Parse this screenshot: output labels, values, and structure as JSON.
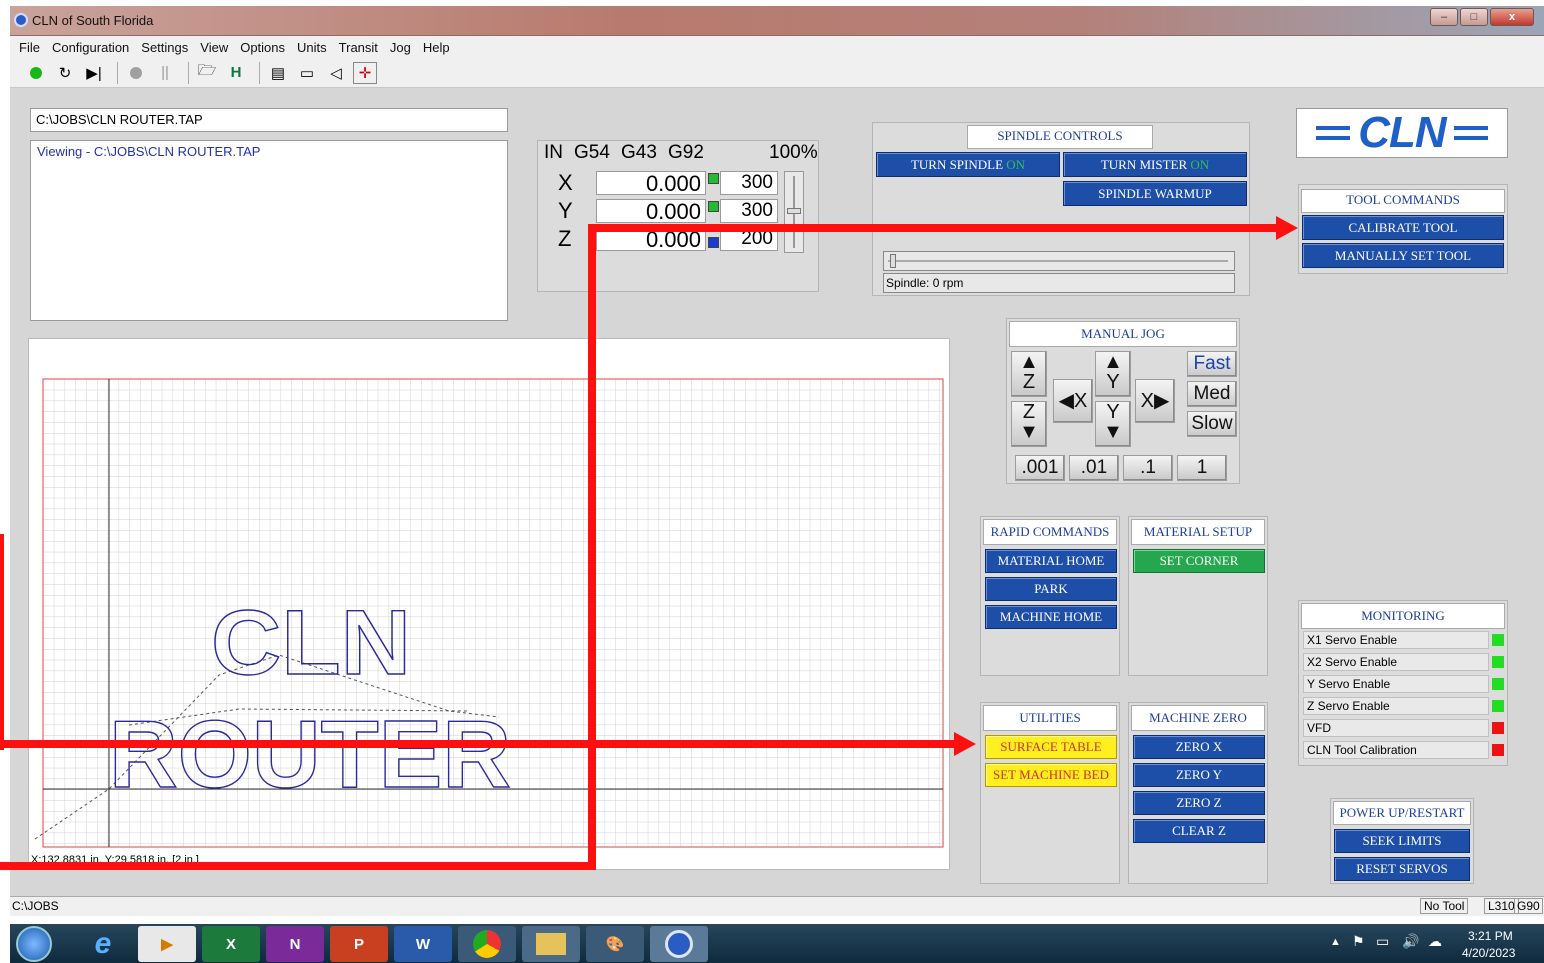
{
  "window": {
    "title": "CLN of South Florida",
    "minimize": "–",
    "maximize": "□",
    "close": "x"
  },
  "menu": [
    "File",
    "Configuration",
    "Settings",
    "View",
    "Options",
    "Units",
    "Transit",
    "Jog",
    "Help"
  ],
  "toolbar_icons": [
    "cycle-start-icon",
    "rewind-icon",
    "single-step-icon",
    "stop-icon",
    "pause-icon",
    "open-file-icon",
    "home-icon",
    "list-icon",
    "window-icon",
    "back-icon",
    "move-icon"
  ],
  "file": {
    "path": "C:\\JOBS\\CLN ROUTER.TAP",
    "viewing": "Viewing - C:\\JOBS\\CLN ROUTER.TAP"
  },
  "dro": {
    "header": {
      "units": "IN",
      "wcs": "G54",
      "tool": "G43",
      "offset": "G92",
      "pct": "100%"
    },
    "axes": [
      {
        "label": "X",
        "value": "0.000",
        "feed": "300",
        "color": "#22bb33"
      },
      {
        "label": "Y",
        "value": "0.000",
        "feed": "300",
        "color": "#22bb33"
      },
      {
        "label": "Z",
        "value": "0.000",
        "feed": "200",
        "color": "#1a3ad6"
      }
    ]
  },
  "spindle": {
    "header": "SPINDLE CONTROLS",
    "turn_spindle": "TURN SPINDLE",
    "turn_mister": "TURN MISTER",
    "on": "ON",
    "warmup": "SPINDLE WARMUP",
    "status": "Spindle: 0 rpm"
  },
  "logo": "CLN",
  "tool_commands": {
    "header": "TOOL COMMANDS",
    "calibrate": "CALIBRATE TOOL",
    "manual": "MANUALLY SET TOOL"
  },
  "manual_jog": {
    "header": "MANUAL JOG",
    "z_up": "Z",
    "z_down": "Z",
    "x_minus": "X",
    "x_plus": "X",
    "y_up": "Y",
    "y_down": "Y",
    "speeds": [
      "Fast",
      "Med",
      "Slow"
    ],
    "steps": [
      ".001",
      ".01",
      ".1",
      "1"
    ]
  },
  "rapid": {
    "header": "RAPID COMMANDS",
    "buttons": [
      "MATERIAL HOME",
      "PARK",
      "MACHINE HOME"
    ]
  },
  "material": {
    "header": "MATERIAL SETUP",
    "buttons": [
      "SET CORNER"
    ]
  },
  "utilities": {
    "header": "UTILITIES",
    "buttons": [
      "SURFACE TABLE",
      "SET MACHINE BED"
    ]
  },
  "machine_zero": {
    "header": "MACHINE ZERO",
    "buttons": [
      "ZERO X",
      "ZERO Y",
      "ZERO Z",
      "CLEAR Z"
    ]
  },
  "monitoring": {
    "header": "MONITORING",
    "rows": [
      {
        "label": "X1 Servo Enable",
        "color": "#22dd22"
      },
      {
        "label": "X2 Servo Enable",
        "color": "#22dd22"
      },
      {
        "label": "Y Servo Enable",
        "color": "#22dd22"
      },
      {
        "label": "Z Servo Enable",
        "color": "#22dd22"
      },
      {
        "label": "VFD",
        "color": "#ee1111"
      },
      {
        "label": "CLN Tool Calibration",
        "color": "#ee1111"
      }
    ]
  },
  "power": {
    "header": "POWER UP/RESTART",
    "buttons": [
      "SEEK LIMITS",
      "RESET SERVOS"
    ]
  },
  "preview": {
    "line1": "CLN",
    "line2": "ROUTER",
    "coords": "X:132.8831 in, Y:29.5818 in, [2 in.]"
  },
  "status": {
    "dir": "C:\\JOBS",
    "tool": "No Tool",
    "line": "L310",
    "mode": "G90"
  },
  "taskbar": {
    "time": "3:21 PM",
    "date": "4/20/2023"
  }
}
